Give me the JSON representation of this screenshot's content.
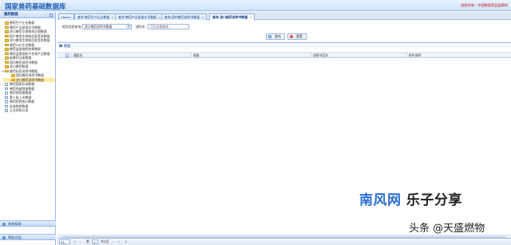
{
  "app": {
    "title": "国家兽药基础数据库",
    "owner": "版权所有：中国兽医药品监察所"
  },
  "sidebar": {
    "header": "兽药数据",
    "items": [
      {
        "label": "兽药生产企业数据",
        "level": 1,
        "type": "folder"
      },
      {
        "label": "兽药产品批准文号数据",
        "level": 1,
        "type": "folder"
      },
      {
        "label": "进口兽药注册和再注册数据",
        "level": 1,
        "type": "folder"
      },
      {
        "label": "国产兽用生物制品批签发数据",
        "level": 1,
        "type": "folder"
      },
      {
        "label": "进口兽用生物制品批签发数据",
        "level": 1,
        "type": "folder"
      },
      {
        "label": "兽药GSP企业数据",
        "level": 1,
        "type": "folder"
      },
      {
        "label": "兽药监督抽检结果数据",
        "level": 1,
        "type": "folder"
      },
      {
        "label": "兽药监督抽检不合格产品数据",
        "level": 1,
        "type": "folder"
      },
      {
        "label": "新兽药注册数据",
        "level": 1,
        "type": "folder"
      },
      {
        "label": "国内兽药说明书数据",
        "level": 1,
        "type": "folder"
      },
      {
        "label": "进口兽药数据",
        "level": 1,
        "type": "folder"
      },
      {
        "label": "兽药标签说明书数据",
        "level": 1,
        "type": "folder-open"
      },
      {
        "label": "国内兽药说明书数据",
        "level": 2,
        "type": "folder"
      },
      {
        "label": "进口兽药说明书数据",
        "level": 2,
        "type": "folder",
        "selected": true
      },
      {
        "label": "兽药国家标准数据",
        "level": 1,
        "type": "doc"
      },
      {
        "label": "兽药残留限量数据",
        "level": 1,
        "type": "doc"
      },
      {
        "label": "兽药停药期数据",
        "level": 1,
        "type": "doc"
      },
      {
        "label": "第十批上市数据",
        "level": 1,
        "type": "doc"
      },
      {
        "label": "兽药检验统计数据",
        "level": 1,
        "type": "doc"
      },
      {
        "label": "标准物质数据",
        "level": 1,
        "type": "doc"
      },
      {
        "label": "企业承担记录",
        "level": 1,
        "type": "doc"
      }
    ],
    "bottom_panels": [
      "系统帮助",
      "帮助文档"
    ]
  },
  "tabs": [
    {
      "label": "Home",
      "active": false
    },
    {
      "label": "查询 兽药生产企业数据",
      "active": false
    },
    {
      "label": "查询 兽药产品批准文号数据",
      "active": false
    },
    {
      "label": "查询 国内兽药说明书数据",
      "active": false
    },
    {
      "label": "查询 进口兽药说明书数据",
      "active": true
    }
  ],
  "search": {
    "category_label": "相关信息查询:",
    "category_value": "进口兽药说明书数据",
    "name_label": "通用名:",
    "name_placeholder": "可为名称查询",
    "search_button": "查询",
    "reset_button": "重置"
  },
  "grid": {
    "title": "数据",
    "columns": [
      "通用名",
      "规格",
      "说明书范本",
      "附件说明"
    ]
  },
  "pager": {
    "page_size": "25",
    "page_label": "第",
    "current_page": "1",
    "total_pages": "共0页"
  },
  "watermark": {
    "part1": "南风网",
    "part2": "乐子分享",
    "line2": "头条 @天盛燃物"
  },
  "colors": {
    "brand": "#1f5fb3",
    "border": "#99bbe8",
    "selected": "#ffe9a0"
  }
}
